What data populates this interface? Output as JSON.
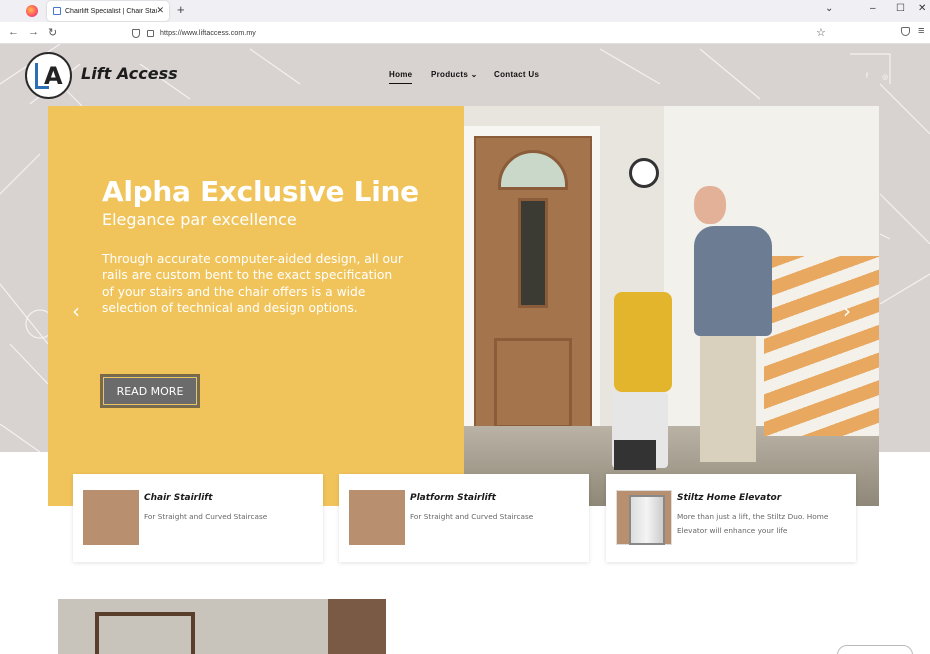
{
  "browser": {
    "tab_title": "Chairlift Specialist | Chair Stairs",
    "tab_close": "✕",
    "new_tab": "+",
    "url": "https://www.liftaccess.com.my",
    "win_min": "⌄",
    "win_minimize": "–",
    "win_max": "☐",
    "win_close": "✕",
    "back": "←",
    "forward": "→",
    "reload": "↻",
    "star": "☆",
    "menu": "≡"
  },
  "site": {
    "brand": "Lift Access",
    "logo_letter": "A",
    "nav": {
      "home": "Home",
      "products": "Products",
      "contact": "Contact Us"
    },
    "social": {
      "facebook": "f",
      "instagram": "◎"
    }
  },
  "hero": {
    "title": "Alpha Exclusive Line",
    "subtitle": "Elegance par excellence",
    "description": "Through accurate computer-aided design, all our rails are custom bent to the exact specification of your stairs and the chair offers is a wide selection of technical and design options.",
    "button": "READ MORE",
    "prev": "‹",
    "next": "›"
  },
  "cards": [
    {
      "title": "Chair Stairlift",
      "desc": "For Straight and Curved Staircase"
    },
    {
      "title": "Platform Stairlift",
      "desc": "For Straight and Curved Staircase"
    },
    {
      "title": "Stiltz Home Elevator",
      "desc": "More than just a lift, the Stiltz Duo. Home Elevator will enhance your life"
    }
  ],
  "colors": {
    "hero_yellow": "#f0c45a",
    "background_grey": "#d8d2d0",
    "button_grey": "#6b6b6b",
    "logo_blue": "#2d6fb7"
  }
}
